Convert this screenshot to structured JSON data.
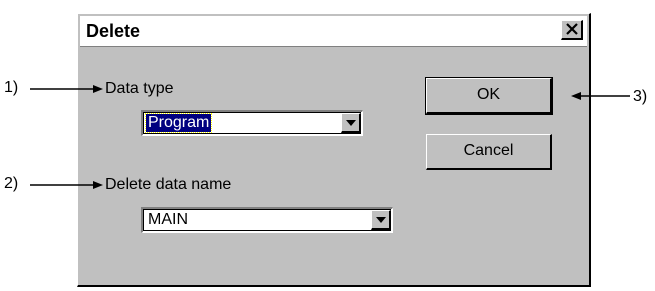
{
  "dialog": {
    "title": "Delete",
    "close_icon": "close-icon",
    "data_type_label": "Data type",
    "data_type_value": "Program",
    "delete_name_label": "Delete data name",
    "delete_name_value": "MAIN",
    "ok_label": "OK",
    "cancel_label": "Cancel"
  },
  "callouts": {
    "c1": "1)",
    "c2": "2)",
    "c3": "3)"
  },
  "colors": {
    "dialog_face": "#c0c0c0",
    "selection": "#000080"
  }
}
